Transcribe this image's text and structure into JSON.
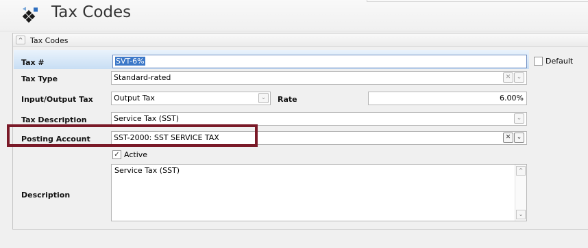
{
  "header": {
    "title": "Tax Codes",
    "icon": "diamond-grid-icon"
  },
  "panel": {
    "title": "Tax Codes",
    "collapse_glyph": "^"
  },
  "form": {
    "tax_no": {
      "label": "Tax #",
      "value": "SVT-6%"
    },
    "default": {
      "label": "Default",
      "checked": false
    },
    "tax_type": {
      "label": "Tax Type",
      "value": "Standard-rated"
    },
    "input_output": {
      "label": "Input/Output Tax",
      "value": "Output Tax"
    },
    "rate": {
      "label": "Rate",
      "value": "6.00%"
    },
    "tax_description": {
      "label": "Tax Description",
      "value": "Service Tax (SST)"
    },
    "posting_account": {
      "label": "Posting Account",
      "value": "SST-2000: SST SERVICE TAX"
    },
    "active": {
      "label": "Active",
      "checked": true
    },
    "description": {
      "label": "Description",
      "value": "Service Tax (SST)"
    }
  },
  "glyphs": {
    "clear": "✕",
    "dropdown": "⌄",
    "check": "✓",
    "scroll_up": "^",
    "scroll_down": "⌄"
  },
  "colors": {
    "highlight_box": "#7a1a28",
    "selection": "#3c78c8"
  }
}
